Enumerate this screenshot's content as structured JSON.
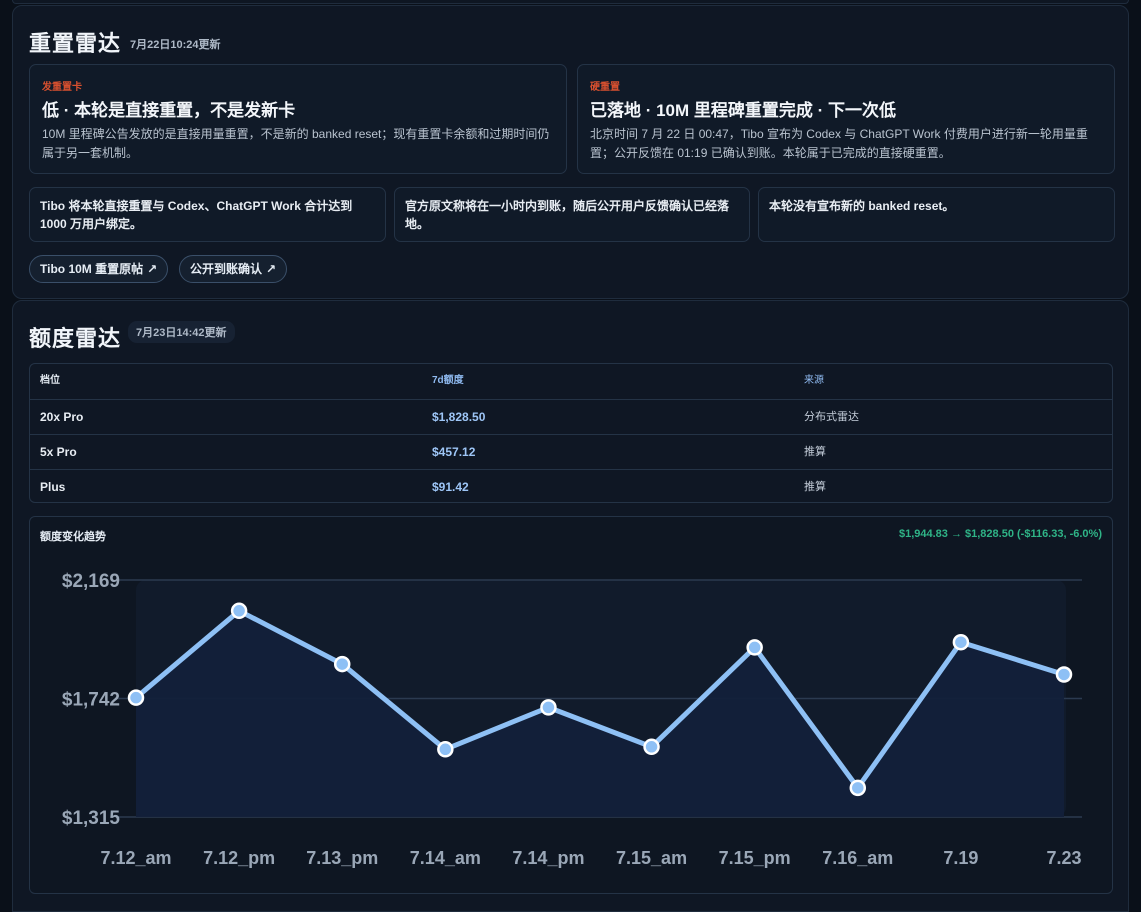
{
  "reset_radar": {
    "title": "重置雷达",
    "updated": "7月22日10:24更新",
    "cards": [
      {
        "tag": "发重置卡",
        "headline": "低 · 本轮是直接重置，不是发新卡",
        "desc": "10M 里程碑公告发放的是直接用量重置，不是新的 banked reset；现有重置卡余额和过期时间仍属于另一套机制。"
      },
      {
        "tag": "硬重置",
        "headline": "已落地 · 10M 里程碑重置完成 · 下一次低",
        "desc": "北京时间 7 月 22 日 00:47，Tibo 宣布为 Codex 与 ChatGPT Work 付费用户进行新一轮用量重置；公开反馈在 01:19 已确认到账。本轮属于已完成的直接硬重置。"
      }
    ],
    "facts": [
      "Tibo 将本轮直接重置与 Codex、ChatGPT Work 合计达到 1000 万用户绑定。",
      "官方原文称将在一小时内到账，随后公开用户反馈确认已经落地。",
      "本轮没有宣布新的 banked reset。"
    ],
    "links": [
      {
        "label": "Tibo 10M 重置原帖",
        "icon": "↗"
      },
      {
        "label": "公开到账确认",
        "icon": "↗"
      }
    ]
  },
  "quota_radar": {
    "title": "额度雷达",
    "updated": "7月23日14:42更新",
    "table": {
      "headers": [
        "档位",
        "7d额度",
        "来源"
      ],
      "rows": [
        [
          "20x Pro",
          "$1,828.50",
          "分布式雷达"
        ],
        [
          "5x Pro",
          "$457.12",
          "推算"
        ],
        [
          "Plus",
          "$91.42",
          "推算"
        ]
      ]
    },
    "trend_title": "额度变化趋势",
    "trend_delta": "$1,944.83 → $1,828.50 (-$116.33, -6.0%)"
  },
  "chart_data": {
    "type": "area",
    "x": [
      "7.12_am",
      "7.12_pm",
      "7.13_pm",
      "7.14_am",
      "7.14_pm",
      "7.15_am",
      "7.15_pm",
      "7.16_am",
      "7.19",
      "7.23"
    ],
    "values": [
      1745,
      2058,
      1866,
      1559,
      1710,
      1568,
      1926,
      1420,
      1944.83,
      1828.5
    ],
    "ylim": [
      1315,
      2169
    ],
    "yticks": [
      "$1,315",
      "$1,742",
      "$2,169"
    ],
    "grid": true,
    "colors": {
      "line": "#8ec0f5",
      "fill": "#13203a",
      "point_stroke": "#ffffff"
    }
  }
}
